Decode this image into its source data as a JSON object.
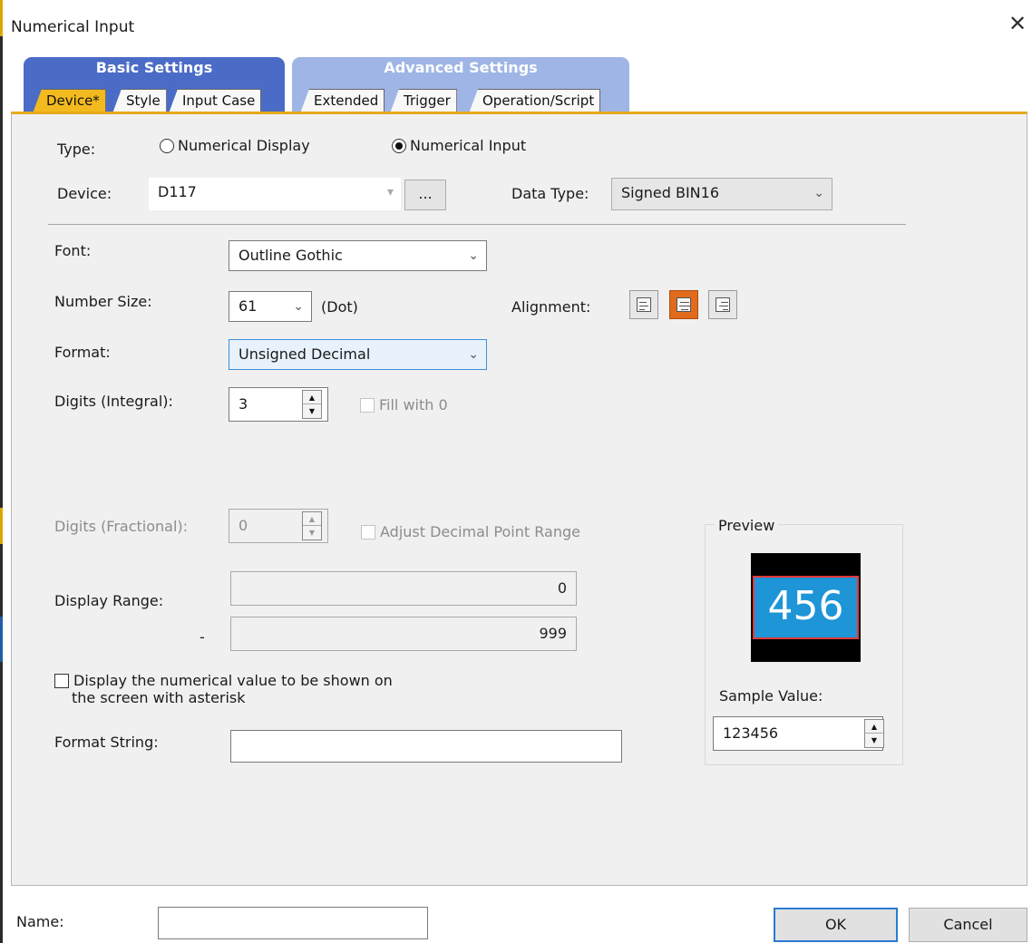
{
  "window": {
    "title": "Numerical Input",
    "close_icon": "close-icon"
  },
  "tab_groups": {
    "basic": {
      "label": "Basic Settings",
      "tabs": [
        "Device*",
        "Style",
        "Input Case"
      ]
    },
    "advanced": {
      "label": "Advanced Settings",
      "tabs": [
        "Extended",
        "Trigger",
        "Operation/Script"
      ]
    }
  },
  "device_section": {
    "type_label": "Type:",
    "type_options": [
      "Numerical Display",
      "Numerical Input"
    ],
    "type_selected": "Numerical Input",
    "device_label": "Device:",
    "device_value": "D117",
    "browse_label": "...",
    "data_type_label": "Data Type:",
    "data_type_value": "Signed BIN16"
  },
  "style_section": {
    "font_label": "Font:",
    "font_value": "Outline Gothic",
    "number_size_label": "Number Size:",
    "number_size_value": "61",
    "number_size_unit": "(Dot)",
    "alignment_label": "Alignment:",
    "alignment_options": [
      "left",
      "center",
      "right"
    ],
    "alignment_selected": "center",
    "format_label": "Format:",
    "format_value": "Unsigned Decimal",
    "digits_integral_label": "Digits (Integral):",
    "digits_integral_value": "3",
    "fill_with_zero_label": "Fill with 0",
    "digits_fractional_label": "Digits (Fractional):",
    "digits_fractional_value": "0",
    "adjust_decimal_label": "Adjust Decimal Point Range",
    "display_range_label": "Display Range:",
    "display_range_min": "0",
    "range_separator": "-",
    "display_range_max": "999",
    "asterisk_label_line1": "Display the numerical value to be shown on",
    "asterisk_label_line2": "the screen with asterisk",
    "format_string_label": "Format String:",
    "format_string_value": ""
  },
  "preview": {
    "title": "Preview",
    "display_value": "456",
    "sample_value_label": "Sample Value:",
    "sample_value": "123456",
    "colors": {
      "frame": "#000000",
      "fill": "#1d95d7",
      "border": "#e23a3a",
      "text": "#ffffff"
    }
  },
  "footer": {
    "name_label": "Name:",
    "name_value": "",
    "ok_label": "OK",
    "cancel_label": "Cancel"
  },
  "colors": {
    "active_tab": "#f3ba1f",
    "basic_group": "#4b6cc6",
    "advanced_group": "#9fb5e6",
    "selected_alignment": "#e06b1d"
  }
}
